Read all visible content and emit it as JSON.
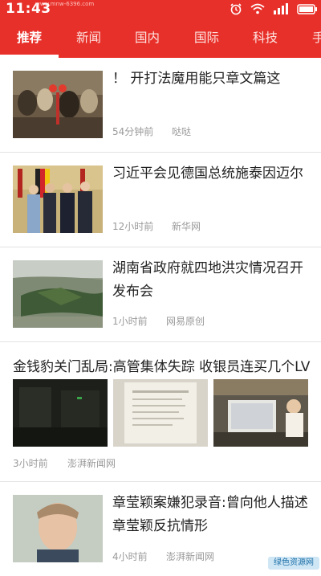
{
  "status_bar": {
    "time": "11:43",
    "watermark": "www.mnw-6396.com",
    "icons": [
      "alarm-icon",
      "wifi-icon",
      "signal-icon",
      "battery-icon"
    ]
  },
  "tabs": [
    {
      "label": "推荐",
      "active": true
    },
    {
      "label": "新闻",
      "active": false
    },
    {
      "label": "国内",
      "active": false
    },
    {
      "label": "国际",
      "active": false
    },
    {
      "label": "科技",
      "active": false
    },
    {
      "label": "手",
      "active": false
    }
  ],
  "articles": [
    {
      "title": "！ 开打法魔用能只章文篇这",
      "time": "54分钟前",
      "source": "哒哒"
    },
    {
      "title": "习近平会见德国总统施泰因迈尔",
      "time": "12小时前",
      "source": "新华网"
    },
    {
      "title": "湖南省政府就四地洪灾情况召开发布会",
      "time": "1小时前",
      "source": "网易原创"
    },
    {
      "title": "金钱豹关门乱局:高管集体失踪 收银员连买几个LV",
      "time": "3小时前",
      "source": "澎湃新闻网"
    },
    {
      "title": "章莹颖案嫌犯录音:曾向他人描述章莹颖反抗情形",
      "time": "4小时前",
      "source": "澎湃新闻网"
    }
  ],
  "colors": {
    "brand_red": "#e8302a",
    "meta_gray": "#9a9a9a"
  },
  "watermark_badge": "绿色资源网"
}
